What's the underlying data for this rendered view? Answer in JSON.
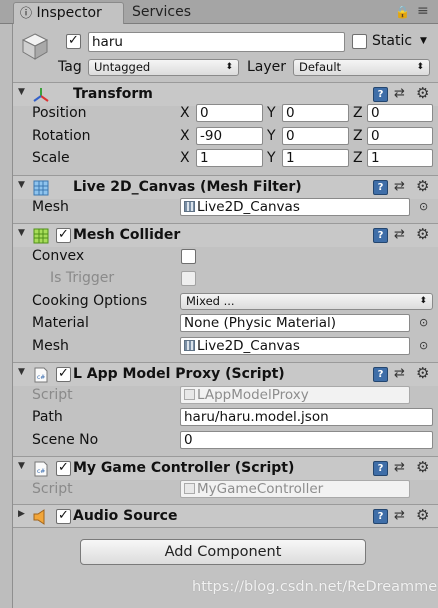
{
  "tabs": [
    {
      "label": "Inspector"
    },
    {
      "label": "Services"
    }
  ],
  "object": {
    "name": "haru",
    "static_label": "Static",
    "tag_label": "Tag",
    "tag_value": "Untagged",
    "layer_label": "Layer",
    "layer_value": "Default"
  },
  "transform": {
    "title": "Transform",
    "position": {
      "label": "Position",
      "x": "0",
      "y": "0",
      "z": "0"
    },
    "rotation": {
      "label": "Rotation",
      "x": "-90",
      "y": "0",
      "z": "0"
    },
    "scale": {
      "label": "Scale",
      "x": "1",
      "y": "1",
      "z": "1"
    },
    "axis_x": "X",
    "axis_y": "Y",
    "axis_z": "Z"
  },
  "mesh_filter": {
    "title": "Live 2D_Canvas (Mesh Filter)",
    "mesh_label": "Mesh",
    "mesh_value": "Live2D_Canvas"
  },
  "mesh_collider": {
    "title": "Mesh Collider",
    "convex_label": "Convex",
    "trigger_label": "Is Trigger",
    "cooking_label": "Cooking Options",
    "cooking_value": "Mixed ...",
    "material_label": "Material",
    "material_value": "None (Physic Material)",
    "mesh_label": "Mesh",
    "mesh_value": "Live2D_Canvas"
  },
  "app_model_proxy": {
    "title": "L App Model Proxy (Script)",
    "script_label": "Script",
    "script_value": "LAppModelProxy",
    "path_label": "Path",
    "path_value": "haru/haru.model.json",
    "scene_label": "Scene No",
    "scene_value": "0"
  },
  "game_controller": {
    "title": "My Game Controller (Script)",
    "script_label": "Script",
    "script_value": "MyGameController"
  },
  "audio_source": {
    "title": "Audio Source"
  },
  "add_component_label": "Add Component",
  "watermark": "https://blog.csdn.net/ReDreamme",
  "colors": {
    "panel": "#c2c2c2",
    "header": "#c8c8c8",
    "help_icon": "#3f6ea8"
  }
}
